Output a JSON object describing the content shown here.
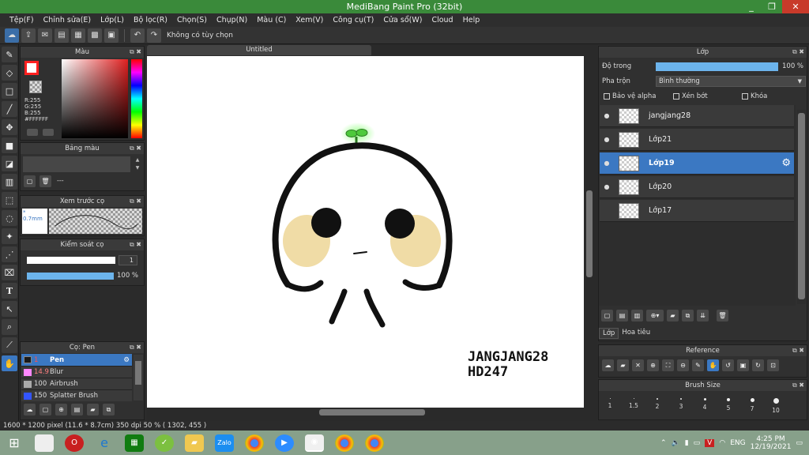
{
  "window": {
    "title": "MediBang Paint Pro (32bit)",
    "controls": [
      "_",
      "❐",
      "✕"
    ]
  },
  "menu": [
    "Tệp(F)",
    "Chỉnh sửa(E)",
    "Lớp(L)",
    "Bộ lọc(R)",
    "Chọn(S)",
    "Chụp(N)",
    "Màu (C)",
    "Xem(V)",
    "Công cụ(T)",
    "Cửa sổ(W)",
    "Cloud",
    "Help"
  ],
  "toolbar": {
    "no_options": "Không có tùy chọn"
  },
  "color_panel": {
    "title": "Màu",
    "r": "R:255",
    "g": "G:255",
    "b": "B:255",
    "hex": "#FFFFFF",
    "primary": "#ff2020"
  },
  "palette_panel": {
    "title": "Bảng màu",
    "value": "---"
  },
  "brush_preview": {
    "title": "Xem trước cọ",
    "size": "* 0.7mm"
  },
  "brush_control": {
    "title": "Kiểm soát cọ",
    "size_value": "1",
    "opacity_value": "100 %"
  },
  "brush_list": {
    "title": "Cọ: Pen",
    "items": [
      {
        "size": "1",
        "name": "Pen",
        "color": "#1a1a1a",
        "active": true
      },
      {
        "size": "14.9",
        "name": "Blur",
        "color": "#ff88ff",
        "active": false
      },
      {
        "size": "100",
        "name": "Airbrush",
        "color": "#aaaaaa",
        "active": false
      },
      {
        "size": "150",
        "name": "Splatter Brush",
        "color": "#3355ff",
        "active": false
      }
    ]
  },
  "document": {
    "tab": "Untitled",
    "signature_line1": "JANGJANG28",
    "signature_line2": "HD247"
  },
  "status": {
    "text": "1600 * 1200 pixel  (11.6 * 8.7cm)  350 dpi  50 %  ( 1302, 455 )"
  },
  "layer_panel": {
    "title": "Lớp",
    "opacity_label": "Độ trong",
    "opacity_value": "100 %",
    "blend_label": "Pha trộn",
    "blend_value": "Bình thường",
    "protect_alpha": "Bảo vệ alpha",
    "clipping": "Xén bớt",
    "lock": "Khóa",
    "layers": [
      {
        "name": "jangjang28",
        "visible": true,
        "active": false
      },
      {
        "name": "Lớp21",
        "visible": true,
        "active": false
      },
      {
        "name": "Lớp19",
        "visible": true,
        "active": true
      },
      {
        "name": "Lớp20",
        "visible": true,
        "active": false
      },
      {
        "name": "Lớp17",
        "visible": false,
        "active": false
      }
    ],
    "tabs": [
      "Lớp",
      "Hoa tiêu"
    ]
  },
  "reference_panel": {
    "title": "Reference"
  },
  "brush_size_panel": {
    "title": "Brush Size",
    "sizes": [
      "1",
      "1.5",
      "2",
      "3",
      "4",
      "5",
      "7",
      "10"
    ]
  },
  "taskbar": {
    "lang": "ENG",
    "time": "4:25 PM",
    "date": "12/19/2021"
  }
}
